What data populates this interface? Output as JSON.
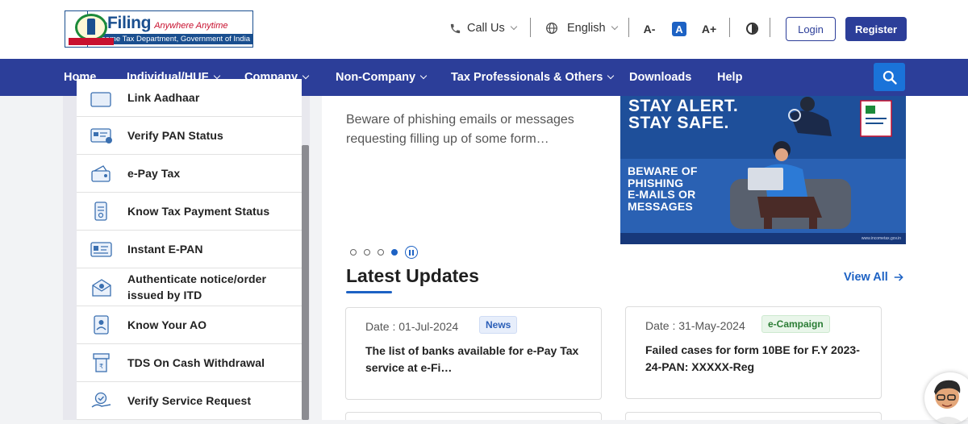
{
  "logo": {
    "title": "e-Filing",
    "tagline": "Anywhere Anytime",
    "subtitle": "Income Tax Department, Government of India",
    "emblem_icon": "national-emblem-icon"
  },
  "header": {
    "call_us": "Call Us",
    "language": "English",
    "font_decrease": "A-",
    "font_normal": "A",
    "font_increase": "A+",
    "login": "Login",
    "register": "Register"
  },
  "nav": {
    "items": [
      {
        "label": "Home",
        "dropdown": false
      },
      {
        "label": "Individual/HUF",
        "dropdown": true
      },
      {
        "label": "Company",
        "dropdown": true
      },
      {
        "label": "Non-Company",
        "dropdown": true
      },
      {
        "label": "Tax Professionals & Others",
        "dropdown": true
      },
      {
        "label": "Downloads",
        "dropdown": false
      },
      {
        "label": "Help",
        "dropdown": false
      }
    ],
    "search_icon": "search-icon"
  },
  "services": {
    "items": [
      {
        "label": "Link Aadhaar",
        "icon": "link-aadhaar-icon"
      },
      {
        "label": "Verify PAN Status",
        "icon": "pan-card-icon"
      },
      {
        "label": "e-Pay Tax",
        "icon": "e-pay-tax-icon"
      },
      {
        "label": "Know Tax Payment Status",
        "icon": "tax-payment-status-icon"
      },
      {
        "label": "Instant E-PAN",
        "icon": "instant-epan-icon"
      },
      {
        "label": "Authenticate notice/order issued by ITD",
        "icon": "authenticate-notice-icon"
      },
      {
        "label": "Know Your AO",
        "icon": "know-your-ao-icon"
      },
      {
        "label": "TDS On Cash Withdrawal",
        "icon": "tds-cash-icon"
      },
      {
        "label": "Verify Service Request",
        "icon": "verify-service-request-icon"
      }
    ]
  },
  "carousel": {
    "teaser": "Beware of phishing emails or messages requesting filling up of some form…",
    "banner_line1": "STAY ALERT.",
    "banner_line2": "STAY SAFE.",
    "banner_beware": [
      "BEWARE OF",
      "PHISHING",
      "E-MAILS OR",
      "MESSAGES"
    ],
    "banner_site": "www.incometax.gov.in",
    "dots": 4,
    "active_dot": 4
  },
  "updates": {
    "title": "Latest Updates",
    "view_all": "View All",
    "cards": [
      {
        "date": "Date : 01-Jul-2024",
        "tag": "News",
        "text": "The list of banks available for e-Pay Tax service at e-Fi…"
      },
      {
        "date": "Date : 31-May-2024",
        "tag": "e-Campaign",
        "text": "Failed cases for form 10BE for F.Y 2023-24-PAN: XXXXX-Reg"
      }
    ]
  },
  "colors": {
    "brand_navy": "#2c3e99",
    "accent_blue": "#1d62c4",
    "campaign_green": "#2b7d35"
  }
}
